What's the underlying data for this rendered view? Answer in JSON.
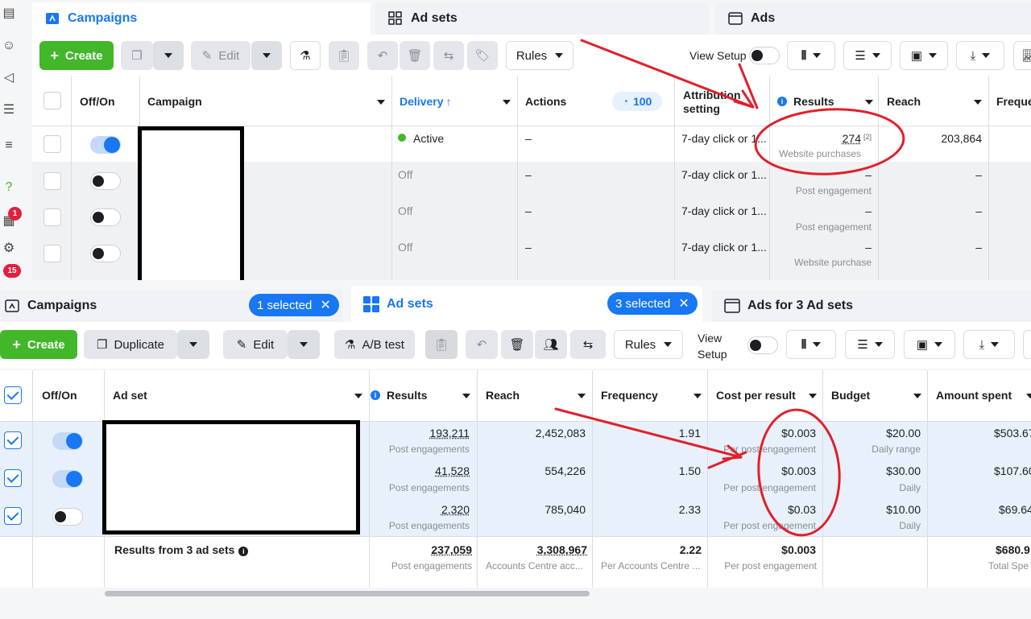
{
  "top": {
    "tabs": {
      "campaigns": "Campaigns",
      "adsets": "Ad sets",
      "ads": "Ads"
    },
    "toolbar": {
      "create": "Create",
      "edit": "Edit",
      "rules": "Rules",
      "view_setup": "View Setup"
    },
    "headers": {
      "offon": "Off/On",
      "campaign": "Campaign",
      "delivery": "Delivery",
      "delivery_sort": "↑",
      "actions": "Actions",
      "actions_count": "100",
      "attribution": "Attribution setting",
      "results": "Results",
      "reach": "Reach",
      "frequency": "Freque"
    },
    "rows": [
      {
        "delivery": "Active",
        "actions": "–",
        "attribution": "7-day click or 1...",
        "results": "274",
        "results_note": "[2]",
        "results_sub": "Website purchases",
        "reach": "203,864"
      },
      {
        "delivery": "Off",
        "actions": "–",
        "attribution": "7-day click or 1...",
        "results": "–",
        "results_sub": "Post engagement",
        "reach": "–"
      },
      {
        "delivery": "Off",
        "actions": "–",
        "attribution": "7-day click or 1...",
        "results": "–",
        "results_sub": "Post engagement",
        "reach": "–"
      },
      {
        "delivery": "Off",
        "actions": "–",
        "attribution": "7-day click or 1...",
        "results": "–",
        "results_sub": "Website purchase",
        "reach": "–"
      }
    ],
    "rail_badges": [
      "1",
      "15"
    ]
  },
  "bottom": {
    "tabs": {
      "campaigns": "Campaigns",
      "campaigns_selected": "1 selected",
      "adsets": "Ad sets",
      "adsets_selected": "3 selected",
      "ads": "Ads for 3 Ad sets"
    },
    "toolbar": {
      "create": "Create",
      "duplicate": "Duplicate",
      "edit": "Edit",
      "abtest": "A/B test",
      "rules": "Rules",
      "view": "View",
      "setup": "Setup"
    },
    "headers": {
      "offon": "Off/On",
      "adset": "Ad set",
      "results": "Results",
      "reach": "Reach",
      "frequency": "Frequency",
      "cost": "Cost per result",
      "budget": "Budget",
      "spent": "Amount spent"
    },
    "rows": [
      {
        "results": "193,211",
        "results_sub": "Post engagements",
        "reach": "2,452,083",
        "frequency": "1.91",
        "cost": "$0.003",
        "cost_sub": "Per post engagement",
        "budget": "$20.00",
        "budget_sub": "Daily range",
        "spent": "$503.67"
      },
      {
        "results": "41,528",
        "results_sub": "Post engagements",
        "reach": "554,226",
        "frequency": "1.50",
        "cost": "$0.003",
        "cost_sub": "Per post engagement",
        "budget": "$30.00",
        "budget_sub": "Daily",
        "spent": "$107.60"
      },
      {
        "results": "2,320",
        "results_sub": "Post engagements",
        "reach": "785,040",
        "frequency": "2.33",
        "cost": "$0.03",
        "cost_sub": "Per post engagement",
        "budget": "$10.00",
        "budget_sub": "Daily",
        "spent": "$69.64"
      }
    ],
    "totals": {
      "label": "Results from 3 ad sets",
      "results": "237,059",
      "results_sub": "Post engagements",
      "reach": "3,308,967",
      "reach_sub": "Accounts Centre acc...",
      "frequency": "2.22",
      "frequency_sub": "Per Accounts Centre ...",
      "cost": "$0.003",
      "cost_sub": "Per post engagement",
      "spent": "$680.9",
      "spent_sub": "Total Spe"
    }
  },
  "colors": {
    "accent": "#1877f2",
    "create_green": "#42b72a",
    "annotation_red": "#e0202a",
    "badge_red": "#e41e3f"
  }
}
